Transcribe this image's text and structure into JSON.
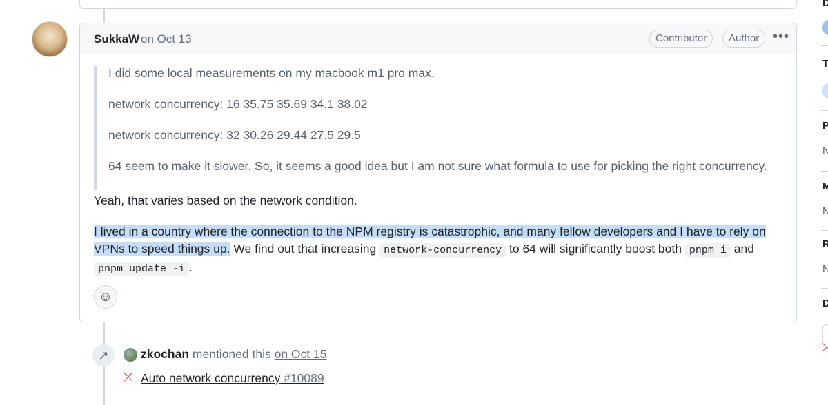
{
  "comment": {
    "author": "SukkaW",
    "date": "on Oct 13",
    "badges": [
      "Contributor",
      "Author"
    ],
    "menu_icon": "kebab-horizontal-icon",
    "quote": [
      "I did some local measurements on my macbook m1 pro max.",
      "network concurrency: 16 35.75 35.69 34.1 38.02",
      "network concurrency: 32 30.26 29.44 27.5 29.5",
      "64 seem to make it slower. So, it seems a good idea but I am not sure what formula to use for picking the right concurrency."
    ],
    "para1": "Yeah, that varies based on the network condition.",
    "para2_highlight": "I lived in a country where the connection to the NPM registry is catastrophic, and many fellow developers and I have to rely on VPNs to speed things up.",
    "para2_a": " We find out that increasing ",
    "code1": "network-concurrency",
    "para2_b": " to 64 will significantly boost both ",
    "code2": "pnpm i",
    "para2_c": " and ",
    "code3": "pnpm update -i",
    "para2_d": ".",
    "reaction_icon": "smiley-icon"
  },
  "event": {
    "user": "zkochan",
    "action": "mentioned this",
    "date": "on Oct 15",
    "pr_title": "Auto network concurrency",
    "pr_number": "#10089"
  },
  "sidebar": {
    "letters": [
      "D",
      "T",
      "P",
      "N",
      "M",
      "N",
      "R",
      "N",
      "D"
    ]
  },
  "colors": {
    "highlight": "#c5ddf7",
    "pr_closed": "#cf222e"
  }
}
